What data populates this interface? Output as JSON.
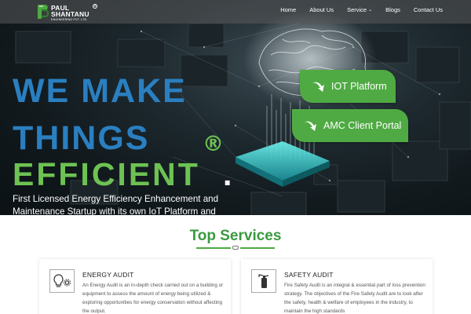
{
  "nav": {
    "logo": {
      "name_line1": "PAUL",
      "name_line2": "SHANTANU",
      "registered": "®",
      "subtitle": "ENGINEERING PVT. LTD."
    },
    "links": [
      {
        "label": "Home"
      },
      {
        "label": "About Us"
      },
      {
        "label": "Service",
        "has_dropdown": true,
        "caret": "⌄"
      },
      {
        "label": "Blogs"
      },
      {
        "label": "Contact Us"
      }
    ]
  },
  "hero": {
    "headline_line1": "WE MAKE",
    "headline_line2": "THINGS",
    "headline_line3": "EFFICIENT",
    "registered_mark": "®",
    "period": ".",
    "description": "First Licensed Energy Efficiency Enhancement and Maintenance Startup with its own IoT Platform and",
    "cta_buttons": [
      {
        "label": "IOT Platform",
        "icon": "curved-arrow-icon"
      },
      {
        "label": "AMC Client Portal",
        "icon": "curved-arrow-icon"
      }
    ]
  },
  "services": {
    "title": "Top Services",
    "cards": [
      {
        "title": "ENERGY AUDIT",
        "icon": "lightbulb-gear-icon",
        "text": "An Energy Audit is an in-depth check carried out on a building or equipment to assess the amount of energy being utilized & exploring opportunities for energy conservation without affecting the output."
      },
      {
        "title": "SAFETY AUDIT",
        "icon": "fire-extinguisher-icon",
        "text": "Fire Safety Audit is an integral & essential part of loss prevention strategy. The objectives of the Fire Safety Audit are to look after the safety, health & welfare of employees in the industry, to maintain the high standards"
      }
    ]
  },
  "colors": {
    "brand_green": "#4faa43",
    "headline_blue": "#2a7fc0",
    "headline_green": "#6dc253",
    "services_title_green": "#3a9a3f"
  }
}
